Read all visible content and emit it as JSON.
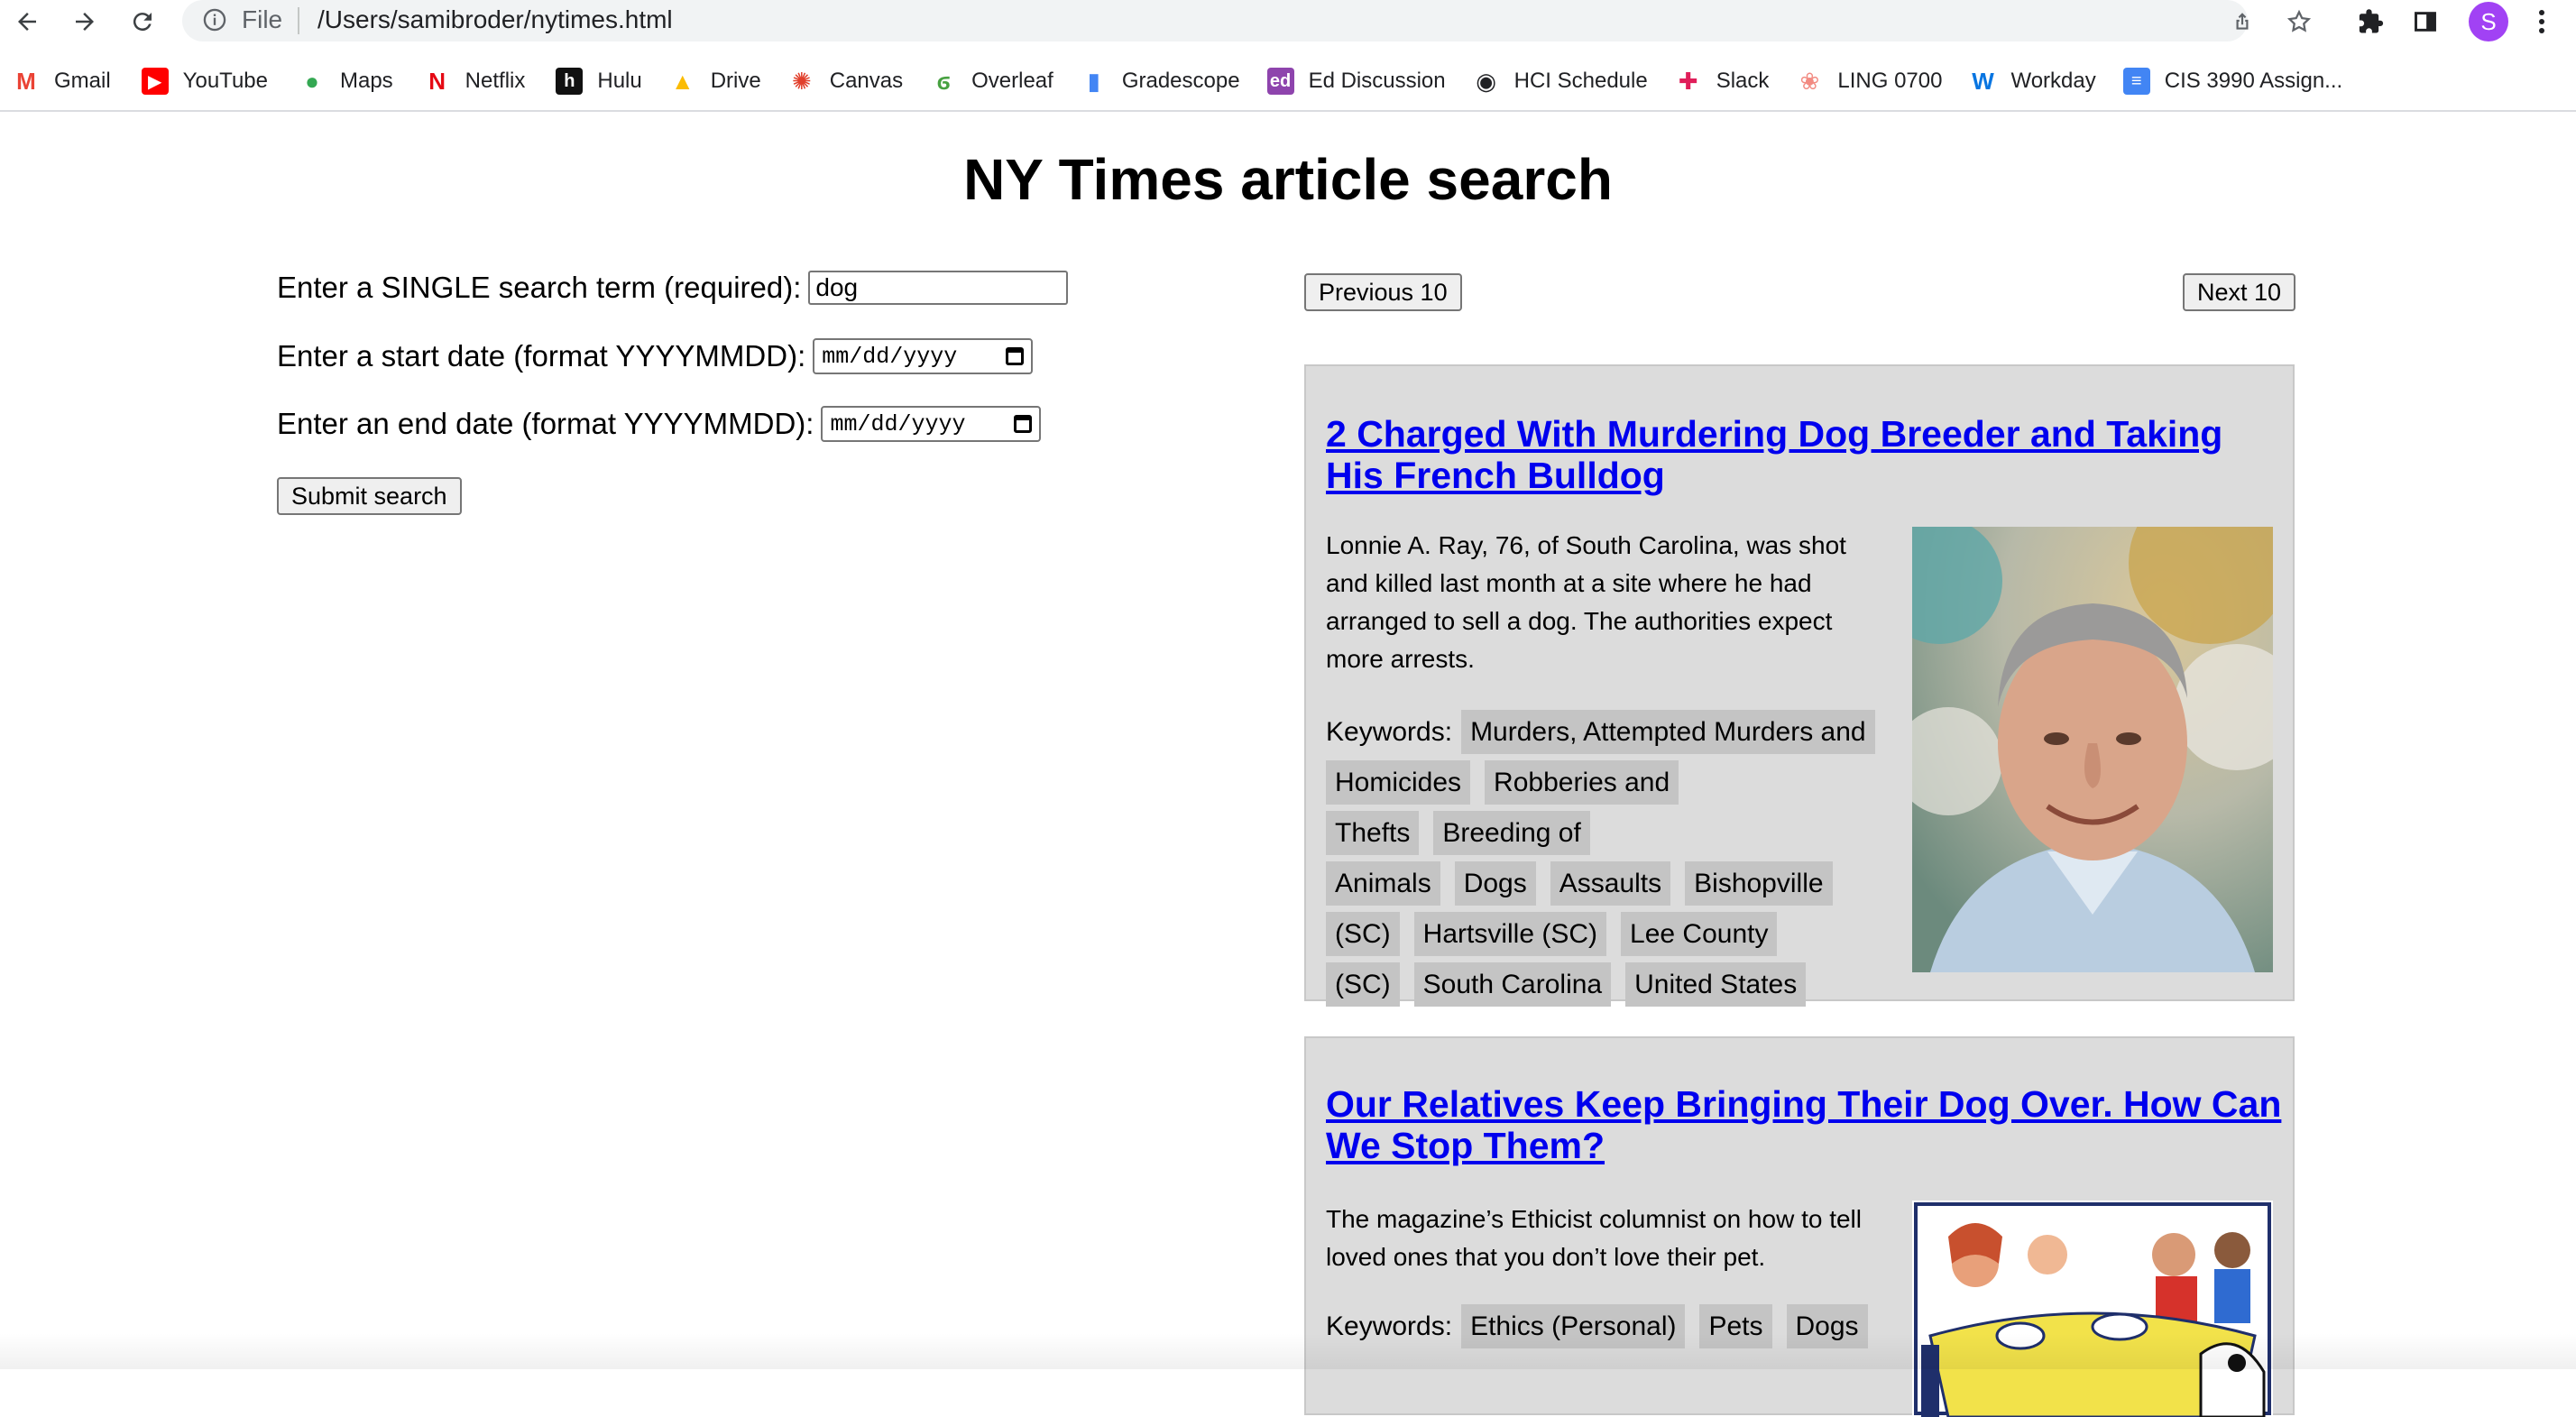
{
  "browser": {
    "file_label": "File",
    "url": "/Users/samibroder/nytimes.html",
    "avatar_initial": "S",
    "bookmarks": [
      {
        "label": "Gmail",
        "icon": "gmail-icon",
        "color": "#ea4335"
      },
      {
        "label": "YouTube",
        "icon": "youtube-icon",
        "color": "#ff0000"
      },
      {
        "label": "Maps",
        "icon": "maps-icon",
        "color": "#34a853"
      },
      {
        "label": "Netflix",
        "icon": "netflix-icon",
        "color": "#e50914"
      },
      {
        "label": "Hulu",
        "icon": "hulu-icon",
        "color": "#1ce783"
      },
      {
        "label": "Drive",
        "icon": "drive-icon",
        "color": "#fbbc04"
      },
      {
        "label": "Canvas",
        "icon": "canvas-icon",
        "color": "#e13f2b"
      },
      {
        "label": "Overleaf",
        "icon": "overleaf-icon",
        "color": "#47a141"
      },
      {
        "label": "Gradescope",
        "icon": "gradescope-icon",
        "color": "#4285f4"
      },
      {
        "label": "Ed Discussion",
        "icon": "ed-icon",
        "color": "#8e44ad"
      },
      {
        "label": "HCI Schedule",
        "icon": "globe-icon",
        "color": "#202124"
      },
      {
        "label": "Slack",
        "icon": "slack-icon",
        "color": "#e01e5a"
      },
      {
        "label": "LING 0700",
        "icon": "brain-icon",
        "color": "#f28b82"
      },
      {
        "label": "Workday",
        "icon": "workday-icon",
        "color": "#0875e1"
      },
      {
        "label": "CIS 3990 Assign...",
        "icon": "docs-icon",
        "color": "#4285f4"
      }
    ]
  },
  "page": {
    "title": "NY Times article search",
    "form": {
      "search_label": "Enter a SINGLE search term (required):",
      "search_value": "dog",
      "start_label": "Enter a start date (format YYYYMMDD):",
      "start_placeholder": "mm/dd/yyyy",
      "end_label": "Enter an end date (format YYYYMMDD):",
      "end_placeholder": "mm/dd/yyyy",
      "submit_label": "Submit search"
    },
    "pagination": {
      "prev_label": "Previous 10",
      "next_label": "Next 10"
    },
    "keywords_label": "Keywords:",
    "articles": [
      {
        "title": "2 Charged With Murdering Dog Breeder and Taking His French Bulldog",
        "abstract": "Lonnie A. Ray, 76, of South Carolina, was shot and killed last month at a site where he had arranged to sell a dog. The authorities expect more arrests.",
        "keywords": [
          "Murders, Attempted Murders and Homicides",
          "Robberies and Thefts",
          "Breeding of Animals",
          "Dogs",
          "Assaults",
          "Bishopville (SC)",
          "Hartsville (SC)",
          "Lee County (SC)",
          "South Carolina",
          "United States"
        ]
      },
      {
        "title": "Our Relatives Keep Bringing Their Dog Over. How Can We Stop Them?",
        "abstract": "The magazine’s Ethicist columnist on how to tell loved ones that you don’t love their pet.",
        "keywords": [
          "Ethics (Personal)",
          "Pets",
          "Dogs"
        ]
      }
    ]
  }
}
